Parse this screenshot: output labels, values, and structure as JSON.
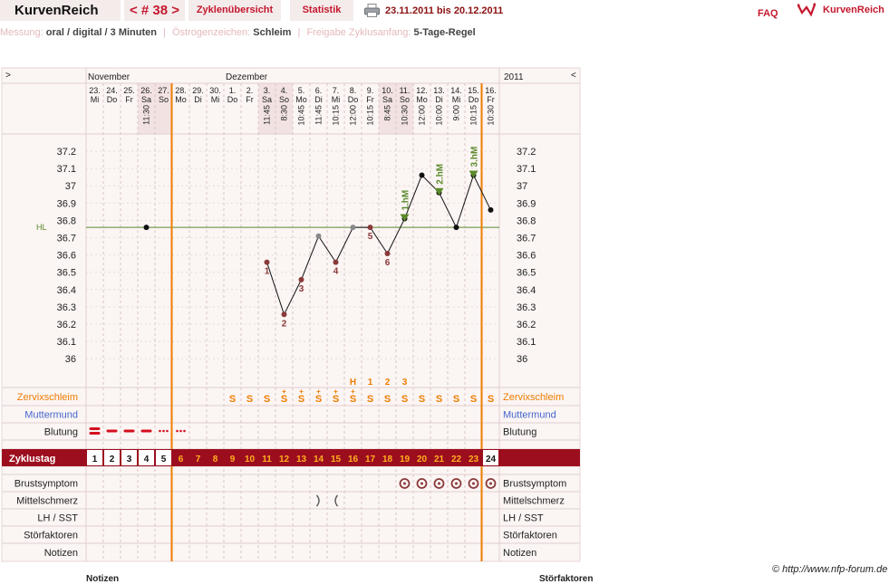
{
  "header": {
    "brand": "KurvenReich",
    "cycle_number": "< # 38 >",
    "tab_cycle_overview": "Zyklenübersicht",
    "tab_statistics": "Statistik",
    "date_range": "23.11.2011 bis 20.12.2011",
    "faq": "FAQ",
    "logo_text": "KurvenReich",
    "icons": {
      "print": "printer-icon",
      "logo": "curve-logo-icon"
    }
  },
  "settings": {
    "measure_label": "Messung:",
    "measure_value": "oral / digital / 3 Minuten",
    "sign_label": "Östrogenzeichen:",
    "sign_value": "Schleim",
    "release_label": "Freigabe Zyklusanfang:",
    "release_value": "5-Tage-Regel"
  },
  "nav": {
    "left_toggle": ">",
    "right_toggle": "<",
    "year": "2011"
  },
  "months": [
    {
      "label": "November",
      "day_index": 0
    },
    {
      "label": "Dezember",
      "day_index": 8
    }
  ],
  "days": [
    {
      "d": "23.",
      "wd": "Mi",
      "time": ""
    },
    {
      "d": "24.",
      "wd": "Do",
      "time": ""
    },
    {
      "d": "25.",
      "wd": "Fr",
      "time": ""
    },
    {
      "d": "26.",
      "wd": "Sa",
      "time": "11:30"
    },
    {
      "d": "27.",
      "wd": "So",
      "time": ""
    },
    {
      "d": "28.",
      "wd": "Mo",
      "time": ""
    },
    {
      "d": "29.",
      "wd": "Di",
      "time": ""
    },
    {
      "d": "30.",
      "wd": "Mi",
      "time": ""
    },
    {
      "d": "1.",
      "wd": "Do",
      "time": ""
    },
    {
      "d": "2.",
      "wd": "Fr",
      "time": ""
    },
    {
      "d": "3.",
      "wd": "Sa",
      "time": "11:45"
    },
    {
      "d": "4.",
      "wd": "So",
      "time": "8:30"
    },
    {
      "d": "5.",
      "wd": "Mo",
      "time": "10:45"
    },
    {
      "d": "6.",
      "wd": "Di",
      "time": "11:45"
    },
    {
      "d": "7.",
      "wd": "Mi",
      "time": "10:15"
    },
    {
      "d": "8.",
      "wd": "Do",
      "time": "12:00"
    },
    {
      "d": "9.",
      "wd": "Fr",
      "time": "10:15"
    },
    {
      "d": "10.",
      "wd": "Sa",
      "time": "8:45"
    },
    {
      "d": "11.",
      "wd": "So",
      "time": "10:30"
    },
    {
      "d": "12.",
      "wd": "Mo",
      "time": "12:00"
    },
    {
      "d": "13.",
      "wd": "Di",
      "time": "10:00"
    },
    {
      "d": "14.",
      "wd": "Mi",
      "time": "9:00"
    },
    {
      "d": "15.",
      "wd": "Do",
      "time": "10:15"
    },
    {
      "d": "16.",
      "wd": "Fr",
      "time": "10:30"
    }
  ],
  "weekend_day_indices": [
    3,
    4,
    10,
    11,
    17,
    18
  ],
  "marker_after_day_indices": [
    4,
    22
  ],
  "chart_data": {
    "type": "line",
    "y_ticks": [
      "37.2",
      "37.1",
      "37",
      "36.9",
      "36.8",
      "36.7",
      "36.6",
      "36.5",
      "36.4",
      "36.3",
      "36.2",
      "36.1",
      "36"
    ],
    "ylim": [
      35.95,
      37.25
    ],
    "hl_label": "HL",
    "hl_value": 36.75,
    "temperatures": [
      {
        "day_index": 3,
        "temp": 36.75,
        "label": ""
      },
      {
        "day_index": 10,
        "temp": 36.55,
        "label": "1"
      },
      {
        "day_index": 11,
        "temp": 36.25,
        "label": "2"
      },
      {
        "day_index": 12,
        "temp": 36.45,
        "label": "3"
      },
      {
        "day_index": 13,
        "temp": 36.7,
        "label": ""
      },
      {
        "day_index": 14,
        "temp": 36.55,
        "label": "4"
      },
      {
        "day_index": 15,
        "temp": 36.75,
        "label": ""
      },
      {
        "day_index": 16,
        "temp": 36.75,
        "label": "5"
      },
      {
        "day_index": 17,
        "temp": 36.6,
        "label": "6"
      },
      {
        "day_index": 18,
        "temp": 36.8,
        "label": ""
      },
      {
        "day_index": 19,
        "temp": 37.05,
        "label": ""
      },
      {
        "day_index": 20,
        "temp": 36.95,
        "label": ""
      },
      {
        "day_index": 21,
        "temp": 36.75,
        "label": ""
      },
      {
        "day_index": 22,
        "temp": 37.05,
        "label": ""
      },
      {
        "day_index": 23,
        "temp": 36.85,
        "label": ""
      }
    ],
    "high_measurements": [
      {
        "day_index": 18,
        "label": "1.hM"
      },
      {
        "day_index": 20,
        "label": "2.hM"
      },
      {
        "day_index": 22,
        "label": "3.hM"
      }
    ],
    "mucus_count_labels": [
      {
        "day_index": 15,
        "label": "H"
      },
      {
        "day_index": 16,
        "label": "1"
      },
      {
        "day_index": 17,
        "label": "2"
      },
      {
        "day_index": 18,
        "label": "3"
      }
    ]
  },
  "rows": {
    "cervical_mucus": "Zervixschleim",
    "cervix": "Muttermund",
    "bleeding": "Blutung",
    "cycle_day": "Zyklustag",
    "breast": "Brustsymptom",
    "midpain": "Mittelschmerz",
    "lh": "LH / SST",
    "disturb": "Störfaktoren",
    "notes": "Notizen"
  },
  "mucus": [
    {
      "day_index": 8,
      "symbol": "S",
      "plus": false
    },
    {
      "day_index": 9,
      "symbol": "S",
      "plus": false
    },
    {
      "day_index": 10,
      "symbol": "S",
      "plus": false
    },
    {
      "day_index": 11,
      "symbol": "S",
      "plus": true
    },
    {
      "day_index": 12,
      "symbol": "S",
      "plus": true
    },
    {
      "day_index": 13,
      "symbol": "S",
      "plus": true
    },
    {
      "day_index": 14,
      "symbol": "S",
      "plus": true
    },
    {
      "day_index": 15,
      "symbol": "S",
      "plus": true
    },
    {
      "day_index": 16,
      "symbol": "S",
      "plus": false
    },
    {
      "day_index": 17,
      "symbol": "S",
      "plus": false
    },
    {
      "day_index": 18,
      "symbol": "S",
      "plus": false
    },
    {
      "day_index": 19,
      "symbol": "S",
      "plus": false
    },
    {
      "day_index": 20,
      "symbol": "S",
      "plus": false
    },
    {
      "day_index": 21,
      "symbol": "S",
      "plus": false
    },
    {
      "day_index": 22,
      "symbol": "S",
      "plus": false
    },
    {
      "day_index": 23,
      "symbol": "S",
      "plus": false
    }
  ],
  "bleeding": [
    {
      "day_index": 0,
      "kind": "strong"
    },
    {
      "day_index": 1,
      "kind": "normal"
    },
    {
      "day_index": 2,
      "kind": "normal"
    },
    {
      "day_index": 3,
      "kind": "normal"
    },
    {
      "day_index": 4,
      "kind": "spotting"
    },
    {
      "day_index": 5,
      "kind": "spotting"
    }
  ],
  "cycle_days": [
    "1",
    "2",
    "3",
    "4",
    "5",
    "6",
    "7",
    "8",
    "9",
    "10",
    "11",
    "12",
    "13",
    "14",
    "15",
    "16",
    "17",
    "18",
    "19",
    "20",
    "21",
    "22",
    "23",
    "24"
  ],
  "breast_symptom_day_indices": [
    18,
    19,
    20,
    21,
    22,
    23
  ],
  "midpain_day_indices": [
    13,
    14
  ],
  "footer": {
    "credit": "© http://www.nfp-forum.de",
    "notes_heading": "Notizen",
    "disturb_heading": "Störfaktoren"
  },
  "colors": {
    "accent_red": "#c4182e",
    "dark_red_band": "#9c0e1e",
    "orange": "#ee7d00",
    "green": "#5a8a2a",
    "blue": "#4466cc",
    "grid_bg": "#fbf5f4",
    "weekend_bg": "#f2e2e2"
  }
}
